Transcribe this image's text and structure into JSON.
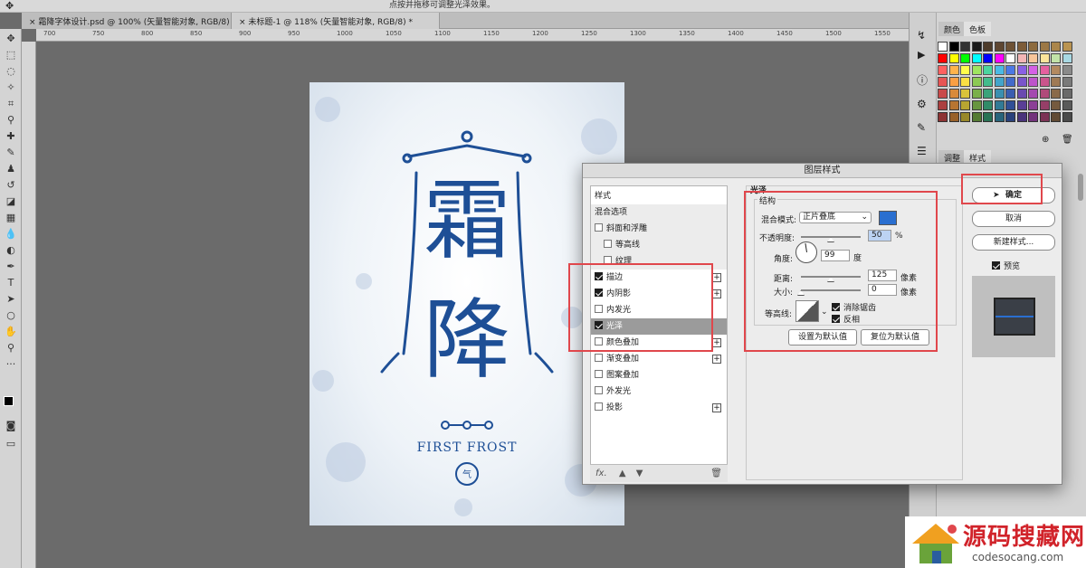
{
  "app": {
    "hint_text": "点按并拖移可调整光泽效果。",
    "doc_tabs": [
      "霜降字体设计.psd @ 100% (矢量智能对象, RGB/8) *",
      "未标题-1 @ 118% (矢量智能对象, RGB/8) *"
    ]
  },
  "ruler": {
    "marks": [
      "700",
      "750",
      "800",
      "850",
      "900",
      "950",
      "1000",
      "1050",
      "1100",
      "1150",
      "1200",
      "1250",
      "1300",
      "1350",
      "1400",
      "1450",
      "1500",
      "1550"
    ]
  },
  "poster": {
    "char_top": "霜",
    "char_bottom": "降",
    "subtitle": "FIRST FROST",
    "seal_char": "气",
    "ink_color": "#1e4f96"
  },
  "right_panel": {
    "tabs_top": [
      "颜色",
      "色板"
    ],
    "tabs_mid": [
      "调整",
      "样式"
    ]
  },
  "dialog": {
    "title": "图层样式",
    "list_header": "样式",
    "items": [
      {
        "label": "混合选项",
        "checkbox": false,
        "checked": false,
        "plus": false,
        "indent": false,
        "selected": false
      },
      {
        "label": "斜面和浮雕",
        "checkbox": true,
        "checked": false,
        "plus": false,
        "indent": false,
        "selected": false
      },
      {
        "label": "等高线",
        "checkbox": true,
        "checked": false,
        "plus": false,
        "indent": true,
        "selected": false
      },
      {
        "label": "纹理",
        "checkbox": true,
        "checked": false,
        "plus": false,
        "indent": true,
        "selected": false
      },
      {
        "label": "描边",
        "checkbox": true,
        "checked": true,
        "plus": true,
        "indent": false,
        "selected": false
      },
      {
        "label": "内阴影",
        "checkbox": true,
        "checked": true,
        "plus": true,
        "indent": false,
        "selected": false
      },
      {
        "label": "内发光",
        "checkbox": true,
        "checked": false,
        "plus": false,
        "indent": false,
        "selected": false
      },
      {
        "label": "光泽",
        "checkbox": true,
        "checked": true,
        "plus": false,
        "indent": false,
        "selected": true
      },
      {
        "label": "颜色叠加",
        "checkbox": true,
        "checked": false,
        "plus": true,
        "indent": false,
        "selected": false
      },
      {
        "label": "渐变叠加",
        "checkbox": true,
        "checked": false,
        "plus": true,
        "indent": false,
        "selected": false
      },
      {
        "label": "图案叠加",
        "checkbox": true,
        "checked": false,
        "plus": false,
        "indent": false,
        "selected": false
      },
      {
        "label": "外发光",
        "checkbox": true,
        "checked": false,
        "plus": false,
        "indent": false,
        "selected": false
      },
      {
        "label": "投影",
        "checkbox": true,
        "checked": false,
        "plus": true,
        "indent": false,
        "selected": false
      }
    ],
    "fx_label": "fx.",
    "section_title": "光泽",
    "group_title": "结构",
    "blend_mode_label": "混合模式:",
    "blend_mode_value": "正片叠底",
    "blend_color": "#2a6fd0",
    "opacity_label": "不透明度:",
    "opacity_value": "50",
    "opacity_unit": "%",
    "angle_label": "角度:",
    "angle_value": "99",
    "angle_unit": "度",
    "distance_label": "距离:",
    "distance_value": "125",
    "distance_unit": "像素",
    "size_label": "大小:",
    "size_value": "0",
    "size_unit": "像素",
    "contour_label": "等高线:",
    "antialias_label": "消除锯齿",
    "antialias_checked": true,
    "invert_label": "反相",
    "invert_checked": true,
    "set_default": "设置为默认值",
    "reset_default": "复位为默认值",
    "ok": "确定",
    "cancel": "取消",
    "new_style": "新建样式...",
    "preview_label": "预览",
    "preview_checked": true
  },
  "watermark": {
    "cn": "源码搜藏网",
    "url": "codesocang.com"
  }
}
